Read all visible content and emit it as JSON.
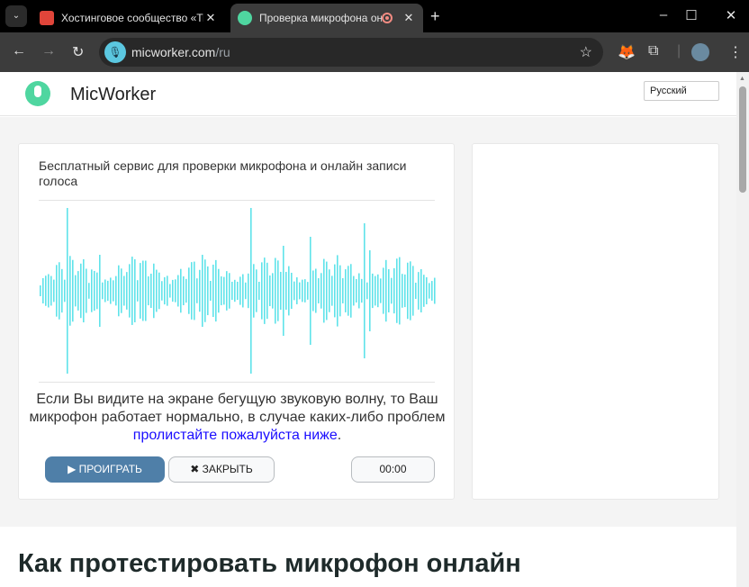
{
  "browser": {
    "tabs": [
      {
        "title": "Хостинговое сообщество «Timeweb»",
        "fav_color": "#e0453a"
      },
      {
        "title": "Проверка микрофона онлайн",
        "fav_color": "#4fd6a0"
      }
    ],
    "url_host": "micworker.com",
    "url_path": "/ru"
  },
  "site": {
    "brand": "MicWorker",
    "language": "Русский"
  },
  "main": {
    "intro": "Бесплатный сервис для проверки микрофона и онлайн записи голоса",
    "message": "Если Вы видите на экране бегущую звуковую волну, то Ваш микрофон работает нормально, в случае каких-либо проблем ",
    "link": "пролистайте пожалуйста ниже",
    "period": ".",
    "play": "▶ ПРОИГРАТЬ",
    "close": "✖ ЗАКРЫТЬ",
    "timer": "00:00"
  },
  "heading": "Как протестировать микрофон онлайн",
  "colors": {
    "wave_start": "#52e0a0",
    "wave_end": "#5fe3ea",
    "play": "#4f7fa8",
    "link": "#1a0dff"
  }
}
